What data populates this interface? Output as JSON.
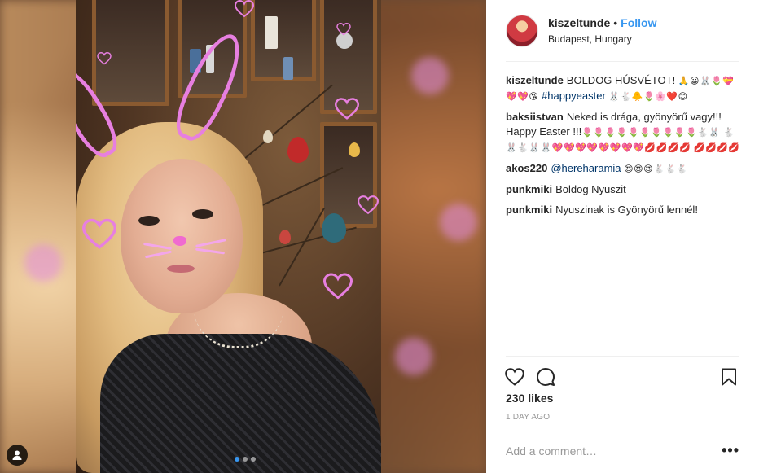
{
  "post": {
    "username": "kiszeltunde",
    "follow_label": "Follow",
    "separator": "•",
    "location": "Budapest, Hungary"
  },
  "comments": [
    {
      "user": "kiszeltunde",
      "text": "BOLDOG HÚSVÉTOT!",
      "emoji1": "🙏😀🐰🌷💝",
      "emoji2": "💖💖😘",
      "hashtag": "#happyeaster",
      "emoji3": "🐰🐇🐥🌷🌸❤️😊"
    },
    {
      "user": "baksiistvan",
      "text": "Neked is drága, gyönyörű vagy!!! Happy Easter !!!",
      "emoji1": "🌷🌷🌷🌷🌷🌷🌷🌷🌷🌷🐇🐰",
      "emoji2": "🐇🐰🐇🐰🐰💖💖💖💖💖💖💖💖💋💋💋💋",
      "emoji3": "💋💋💋💋"
    },
    {
      "user": "akos220",
      "mention": "@hereharamia",
      "emoji1": "😍😍😍🐇🐇🐇"
    },
    {
      "user": "punkmiki",
      "text": "Boldog Nyuszit"
    },
    {
      "user": "punkmiki",
      "text": "Nyuszinak is Gyönyörű lennél!"
    }
  ],
  "likes_text": "230 likes",
  "time_text": "1 DAY AGO",
  "comment_placeholder": "Add a comment…",
  "more_label": "•••",
  "icons": {
    "like": "heart-icon",
    "comment": "comment-icon",
    "save": "bookmark-icon",
    "tag": "user-tag-icon"
  },
  "colors": {
    "follow": "#3897f0",
    "hashtag": "#003569",
    "meta": "#999999",
    "overlay_pink": "#e77fe0"
  }
}
